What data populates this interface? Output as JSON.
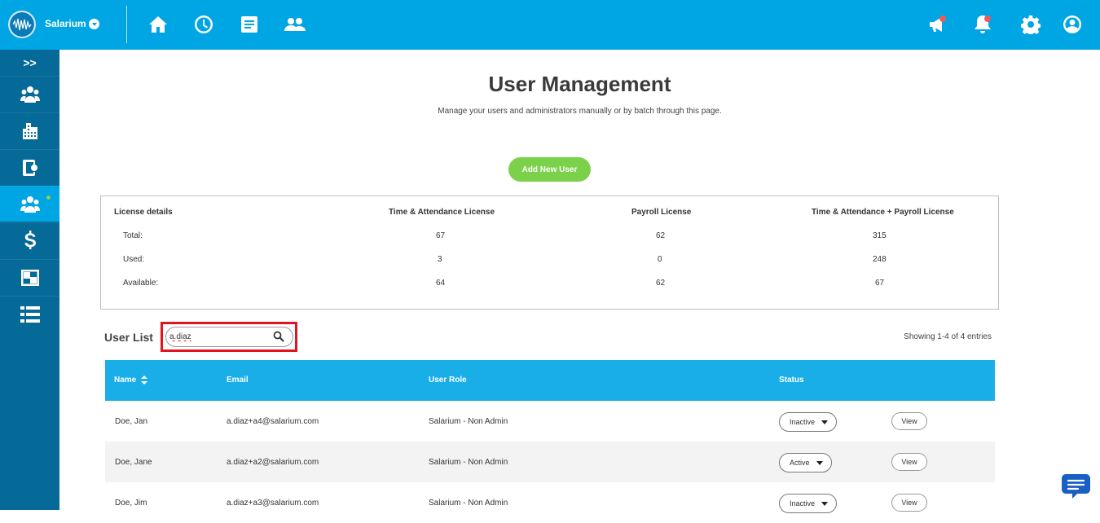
{
  "topbar": {
    "company_name": "Salarium",
    "icons": [
      "home-icon",
      "clock-icon",
      "document-icon",
      "people-icon",
      "megaphone-icon",
      "bell-icon",
      "gear-icon",
      "account-icon"
    ]
  },
  "sidebar": {
    "expand_label": ">>",
    "items": [
      {
        "icon": "employees-icon"
      },
      {
        "icon": "company-icon"
      },
      {
        "icon": "device-icon"
      },
      {
        "icon": "user-management-icon",
        "active": true
      },
      {
        "icon": "payroll-icon"
      },
      {
        "icon": "reports-icon"
      },
      {
        "icon": "list-icon"
      }
    ]
  },
  "main": {
    "title": "User Management",
    "subtitle": "Manage your users and administrators manually or by batch through this page.",
    "add_button": "Add New User"
  },
  "license": {
    "headers": [
      "License details",
      "Time & Attendance License",
      "Payroll License",
      "Time & Attendance + Payroll License"
    ],
    "rows": [
      {
        "label": "Total:",
        "ta": "67",
        "payroll": "62",
        "combined": "315"
      },
      {
        "label": "Used:",
        "ta": "3",
        "payroll": "0",
        "combined": "248"
      },
      {
        "label": "Available:",
        "ta": "64",
        "payroll": "62",
        "combined": "67"
      }
    ]
  },
  "user_list": {
    "label": "User List",
    "search_value": "a.diaz",
    "showing": "Showing 1-4 of 4 entries",
    "columns": [
      "Name",
      "Email",
      "User Role",
      "Status"
    ],
    "rows": [
      {
        "name": "Doe, Jan",
        "email": "a.diaz+a4@salarium.com",
        "role": "Salarium - Non Admin",
        "status": "Inactive",
        "action": "View"
      },
      {
        "name": "Doe, Jane",
        "email": "a.diaz+a2@salarium.com",
        "role": "Salarium - Non Admin",
        "status": "Active",
        "action": "View"
      },
      {
        "name": "Doe, Jim",
        "email": "a.diaz+a3@salarium.com",
        "role": "Salarium - Non Admin",
        "status": "Inactive",
        "action": "View"
      }
    ]
  },
  "colors": {
    "topbar": "#00a5e3",
    "sidebar": "#066a99",
    "accent_green": "#7cd14a",
    "table_header": "#1aaee8",
    "highlight_red": "#e0131f"
  }
}
